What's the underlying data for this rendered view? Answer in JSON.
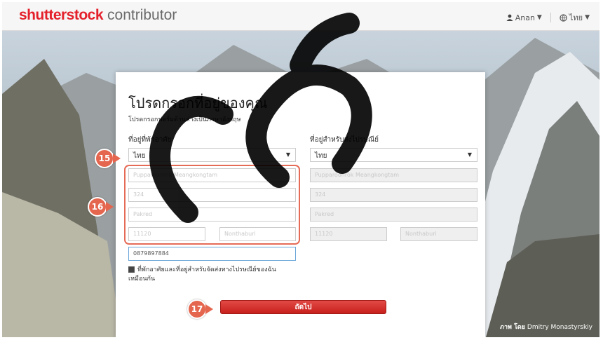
{
  "header": {
    "logo_brand": "shutterstock",
    "logo_sub": "contributor",
    "user_name": "Anan",
    "language": "ไทย"
  },
  "form": {
    "title": "โปรดกรอกที่อยู่ของคุณ",
    "subtitle": "โปรดกรอกฟอร์มด้านล่างเป็นภาษาอังกฤษ",
    "residence_label": "ที่อยู่ที่พักอาศัย",
    "mailing_label": "ที่อยู่สำหรับส่งไปรษณีย์",
    "residence_country": "ไทย",
    "mailing_country": "ไทย",
    "residence_fields": {
      "name": "Pupparoonrok Meangkongtam",
      "address": "324",
      "city": "Pakred",
      "zip": "11120",
      "province": "Nonthaburi"
    },
    "mailing_fields": {
      "name": "Pupparoonrok Meangkongtam",
      "address": "324",
      "city": "Pakred",
      "zip": "11120",
      "province": "Nonthaburi"
    },
    "phone": "0879897884",
    "same_address_label": "ที่พักอาศัยและที่อยู่สำหรับจัดส่งทางไปรษณีย์ของฉันเหมือนกัน",
    "next_button": "ถัดไป"
  },
  "callouts": [
    "15",
    "16",
    "17"
  ],
  "credit": {
    "prefix": "ภาพ โดย",
    "author": "Dmitry Monastyrskiy"
  },
  "colors": {
    "brand_red": "#e4202b",
    "callout": "#e5664f",
    "button_red": "#d42a25"
  }
}
